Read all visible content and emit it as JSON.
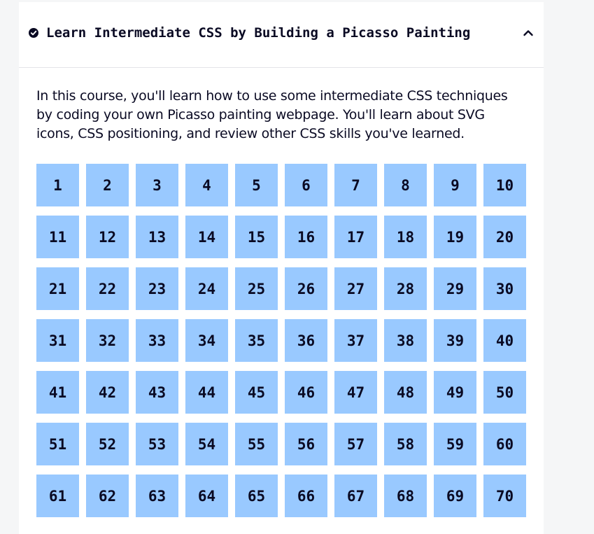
{
  "course": {
    "title": "Learn Intermediate CSS by Building a Picasso Painting",
    "description": "In this course, you'll learn how to use some intermediate CSS techniques by coding your own Picasso painting webpage. You'll learn about SVG icons, CSS positioning, and review other CSS skills you've learned.",
    "completed_icon": "check-circle-icon",
    "toggle_icon": "chevron-up-icon"
  },
  "steps": [
    "1",
    "2",
    "3",
    "4",
    "5",
    "6",
    "7",
    "8",
    "9",
    "10",
    "11",
    "12",
    "13",
    "14",
    "15",
    "16",
    "17",
    "18",
    "19",
    "20",
    "21",
    "22",
    "23",
    "24",
    "25",
    "26",
    "27",
    "28",
    "29",
    "30",
    "31",
    "32",
    "33",
    "34",
    "35",
    "36",
    "37",
    "38",
    "39",
    "40",
    "41",
    "42",
    "43",
    "44",
    "45",
    "46",
    "47",
    "48",
    "49",
    "50",
    "51",
    "52",
    "53",
    "54",
    "55",
    "56",
    "57",
    "58",
    "59",
    "60",
    "61",
    "62",
    "63",
    "64",
    "65",
    "66",
    "67",
    "68",
    "69",
    "70"
  ],
  "colors": {
    "step_background": "#99c9ff",
    "text": "#0a0a23",
    "page_background": "#f5f6f7",
    "card_background": "#ffffff"
  }
}
